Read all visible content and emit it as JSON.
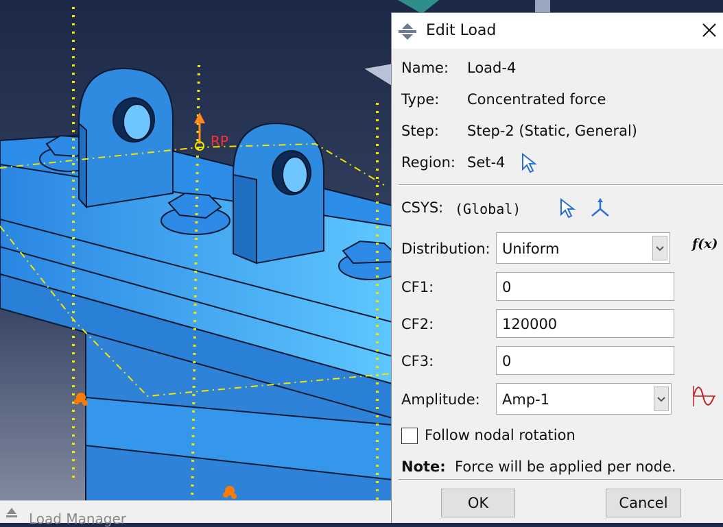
{
  "viewport": {
    "rp_label": "RP"
  },
  "load_manager": {
    "title": "Load Manager"
  },
  "dialog": {
    "title": "Edit Load",
    "name_label": "Name:",
    "name_value": "Load-4",
    "type_label": "Type:",
    "type_value": "Concentrated force",
    "step_label": "Step:",
    "step_value": "Step-2 (Static, General)",
    "region_label": "Region:",
    "region_value": "Set-4",
    "csys_label": "CSYS:",
    "csys_value": "(Global)",
    "distribution_label": "Distribution:",
    "distribution_value": "Uniform",
    "fx_label": "f(x)",
    "cf1_label": "CF1:",
    "cf1_value": "0",
    "cf2_label": "CF2:",
    "cf2_value": "120000",
    "cf3_label": "CF3:",
    "cf3_value": "0",
    "amplitude_label": "Amplitude:",
    "amplitude_value": "Amp-1",
    "follow_label": "Follow nodal rotation",
    "follow_checked": false,
    "note_label": "Note:",
    "note_text": "Force will be applied per node.",
    "ok_label": "OK",
    "cancel_label": "Cancel"
  },
  "colors": {
    "part": "#2f8be0",
    "datum": "#f5e600",
    "accent": "#2a6fd6"
  }
}
